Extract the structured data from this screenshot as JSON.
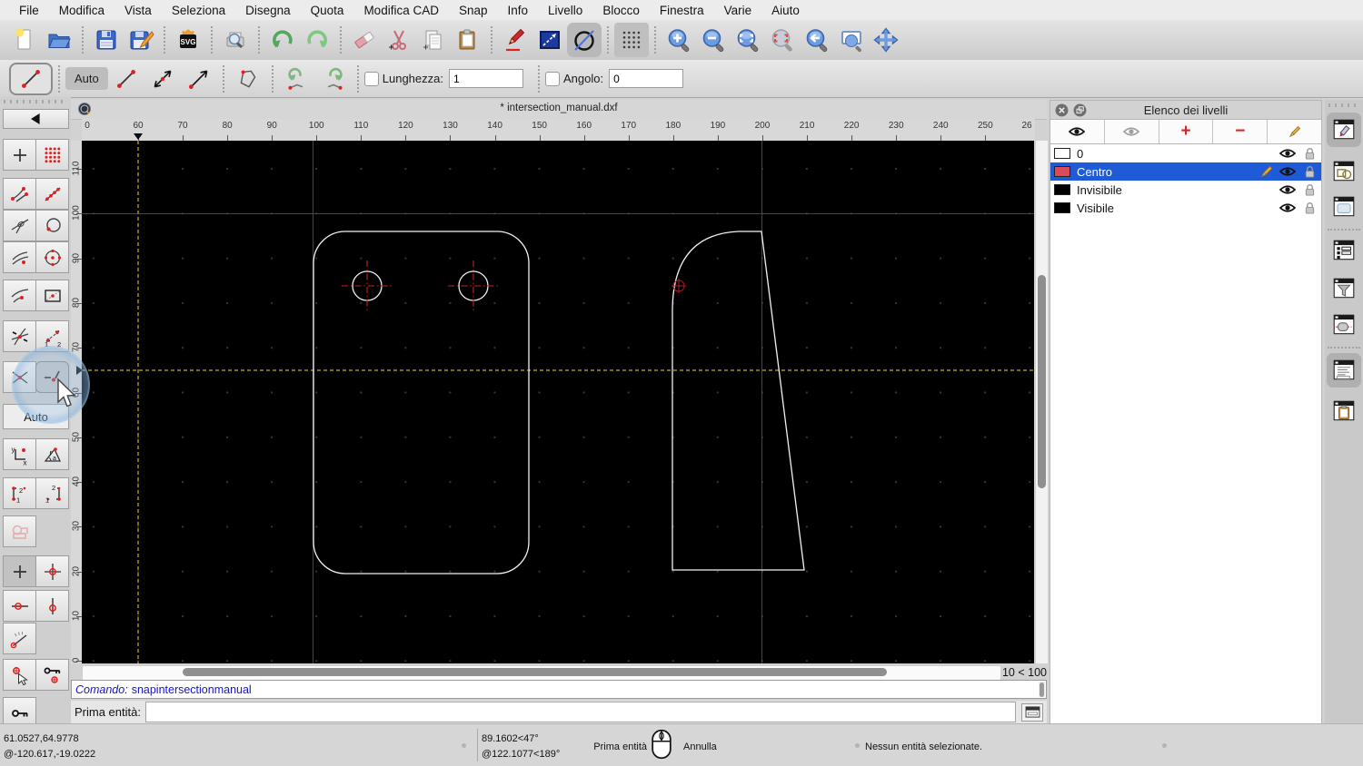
{
  "menu_bar": {
    "items": [
      "File",
      "Modifica",
      "Vista",
      "Seleziona",
      "Disegna",
      "Quota",
      "Modifica CAD",
      "Snap",
      "Info",
      "Livello",
      "Blocco",
      "Finestra",
      "Varie",
      "Aiuto"
    ]
  },
  "tool_options": {
    "auto_label": "Auto",
    "length_label": "Lunghezza:",
    "length_value": "1",
    "angle_label": "Angolo:",
    "angle_value": "0"
  },
  "snap_sidebar": {
    "auto_label": "Auto"
  },
  "document": {
    "title": "* intersection_manual.dxf"
  },
  "rulers": {
    "h_labels": [
      "60",
      "70",
      "80",
      "90",
      "100",
      "110",
      "120",
      "130",
      "140",
      "150",
      "160",
      "170",
      "180",
      "190",
      "200",
      "210",
      "220",
      "230",
      "240",
      "250"
    ],
    "h_partial_left": "0",
    "h_partial_right": "26",
    "v_labels": [
      "110",
      "100",
      "90",
      "80",
      "70",
      "60",
      "50",
      "40",
      "30",
      "20",
      "10",
      "0"
    ]
  },
  "canvas": {
    "zoom_indicator": "10 < 100"
  },
  "layers_panel": {
    "title": "Elenco dei livelli",
    "layers": [
      {
        "name": "0",
        "color": "#ffffff",
        "selected": false
      },
      {
        "name": "Centro",
        "color": "#d84b57",
        "selected": true
      },
      {
        "name": "Invisibile",
        "color": "#000000",
        "selected": false
      },
      {
        "name": "Visibile",
        "color": "#000000",
        "selected": false
      }
    ]
  },
  "command": {
    "history_label": "Comando:",
    "history_value": "snapintersectionmanual",
    "prompt_label": "Prima entità:",
    "input_value": ""
  },
  "status_bar": {
    "abs_coord": "61.0527,64.9778",
    "rel_coord": "@-120.617,-19.0222",
    "abs_polar": "89.1602<47°",
    "rel_polar": "@122.1077<189°",
    "left_click_action": "Prima entità",
    "right_click_action": "Annulla",
    "selection_status": "Nessun entità selezionate."
  },
  "colors": {
    "accent_selection": "#1f5bd6",
    "layer_centro_swatch": "#d84b57",
    "relative_zero_line": "#7d6c12",
    "drawing_stroke": "#f2f2f2",
    "center_cross": "#cc2020"
  }
}
